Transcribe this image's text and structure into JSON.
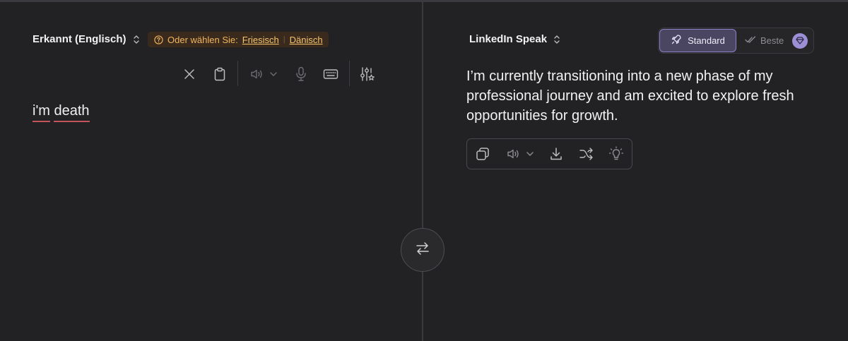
{
  "source": {
    "language_label": "Erkannt (Englisch)",
    "suggestion": {
      "prefix": "Oder wählen Sie:",
      "options": [
        "Friesisch",
        "Dänisch"
      ]
    },
    "text_words": [
      "i'm",
      "death"
    ]
  },
  "target": {
    "language_label": "LinkedIn Speak",
    "modes": {
      "standard_label": "Standard",
      "best_label": "Beste"
    },
    "text": "I’m currently transitioning into a new phase of my professional journey and am excited to explore fresh opportunities for growth."
  },
  "icons": {
    "source_toolbar": [
      "close-icon",
      "clipboard-icon",
      "speaker-icon",
      "chevron-down-icon",
      "microphone-icon",
      "keyboard-icon",
      "sliders-sparkle-icon"
    ],
    "target_actions": [
      "copy-icon",
      "speaker-icon",
      "chevron-down-icon",
      "download-icon",
      "shuffle-icon",
      "lightbulb-icon"
    ],
    "swap": "swap-arrows-icon"
  },
  "colors": {
    "background": "#222124",
    "accent": "#8d80c8",
    "suggestion_text": "#f2b65c",
    "spellcheck_underline": "#c4545c"
  }
}
